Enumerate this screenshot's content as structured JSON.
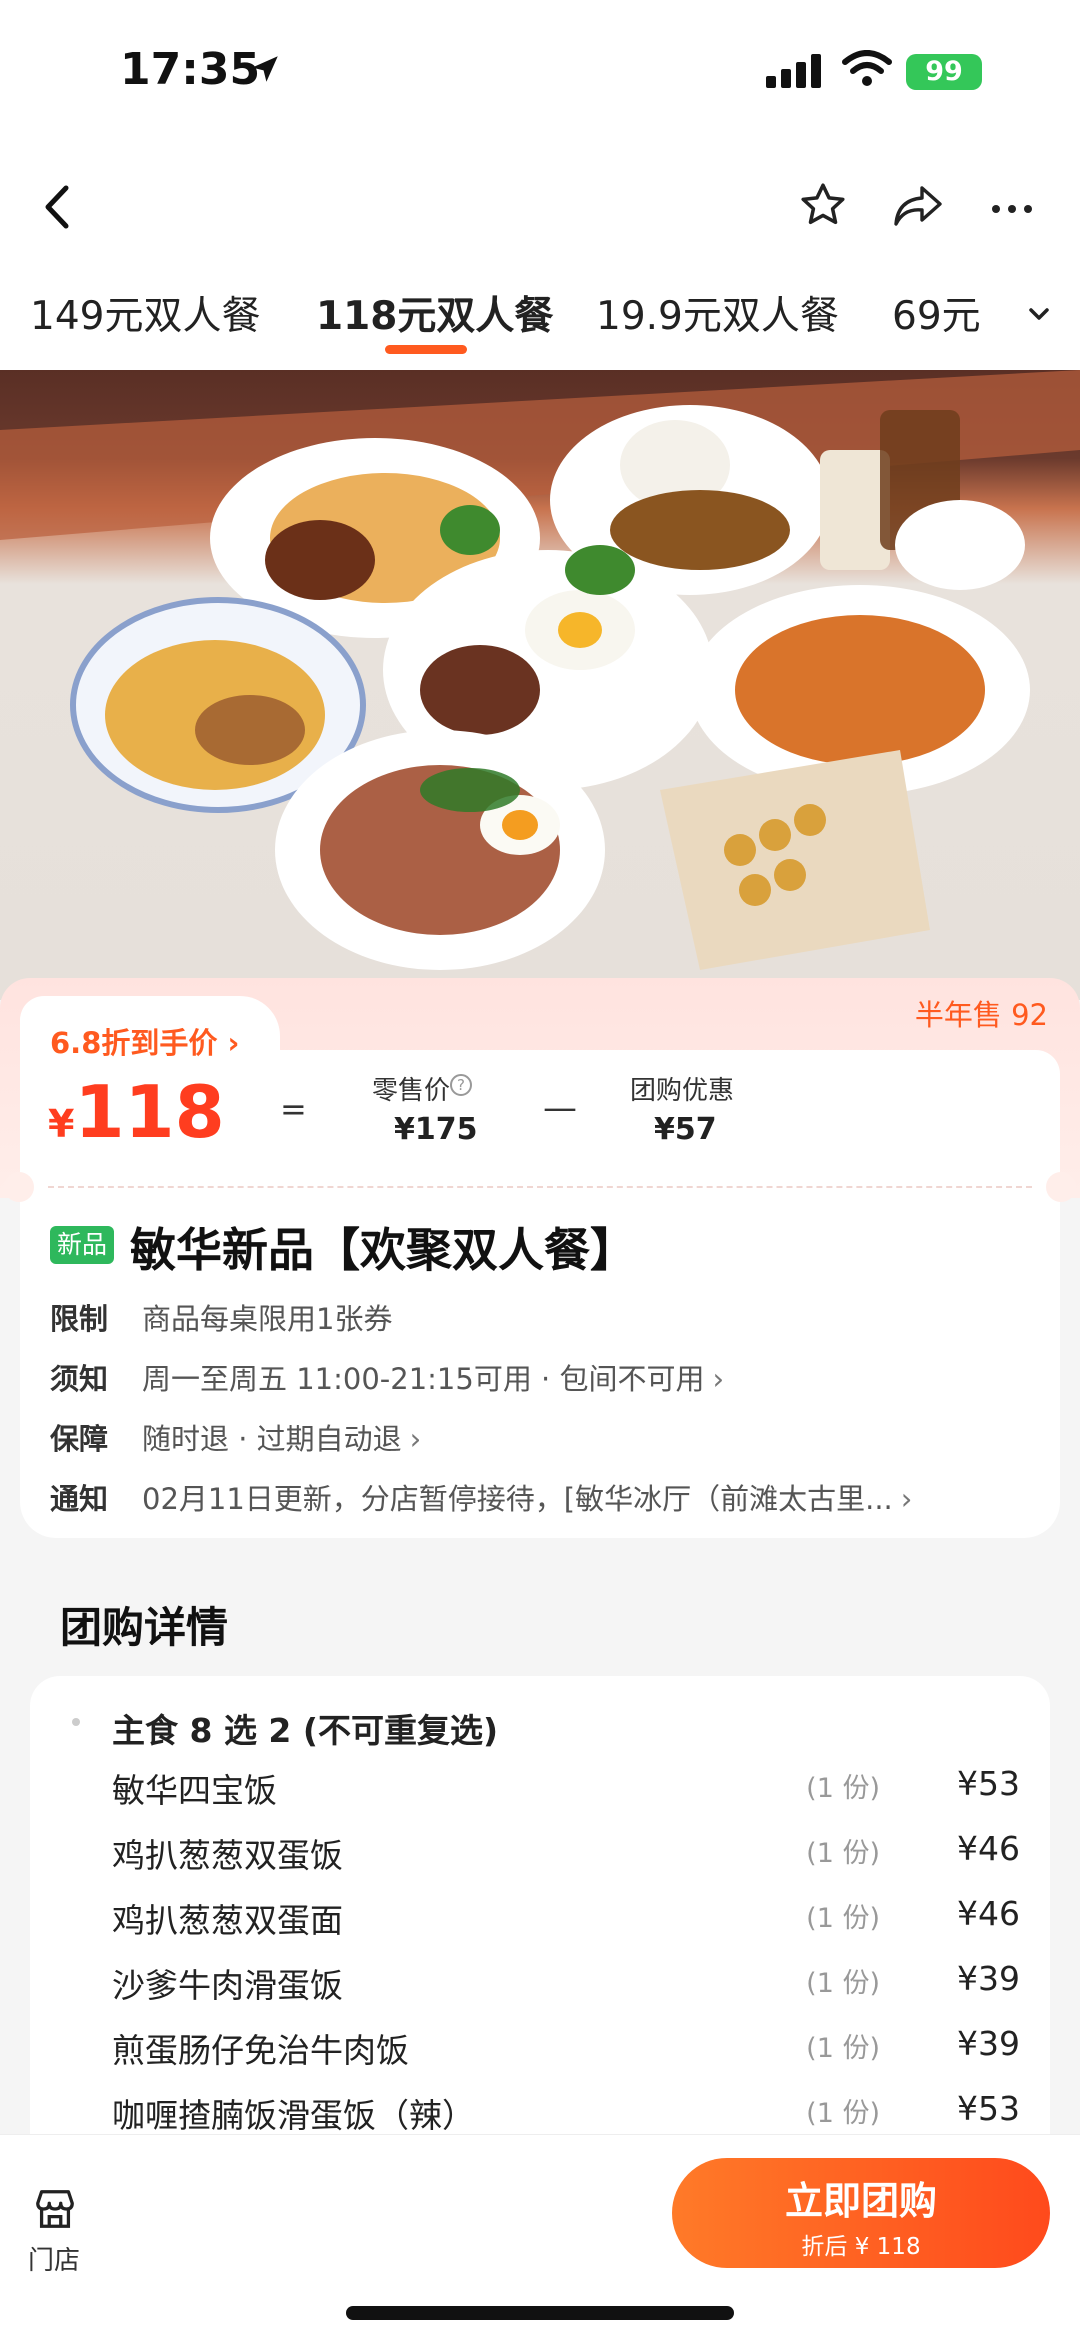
{
  "status_bar": {
    "time": "17:35",
    "battery": "99"
  },
  "tabs": [
    {
      "label": "149元双人餐"
    },
    {
      "label": "118元双人餐"
    },
    {
      "label": "19.9元双人餐"
    },
    {
      "label": "69元"
    }
  ],
  "price": {
    "discount_label": "6.8折到手价",
    "half_year_sales": "半年售 92",
    "currency": "¥",
    "amount": "118",
    "equals": "=",
    "retail_label": "零售价",
    "retail_value": "¥175",
    "minus": "—",
    "group_label": "团购优惠",
    "group_value": "¥57"
  },
  "product": {
    "badge": "新品",
    "title": "敏华新品【欢聚双人餐】",
    "rows": [
      {
        "key": "限制",
        "value": "商品每桌限用1张券"
      },
      {
        "key": "须知",
        "value": "周一至周五 11:00-21:15可用 · 包间不可用"
      },
      {
        "key": "保障",
        "value": "随时退 · 过期自动退"
      },
      {
        "key": "通知",
        "value": "02月11日更新，分店暂停接待，[敏华冰厅（前滩太古里..."
      }
    ]
  },
  "details": {
    "section_title": "团购详情",
    "group_head": "主食 8 选 2 (不可重复选)",
    "items": [
      {
        "name": "敏华四宝饭",
        "qty": "(1 份)",
        "price": "¥53"
      },
      {
        "name": "鸡扒葱葱双蛋饭",
        "qty": "(1 份)",
        "price": "¥46"
      },
      {
        "name": "鸡扒葱葱双蛋面",
        "qty": "(1 份)",
        "price": "¥46"
      },
      {
        "name": "沙爹牛肉滑蛋饭",
        "qty": "(1 份)",
        "price": "¥39"
      },
      {
        "name": "煎蛋肠仔免治牛肉饭",
        "qty": "(1 份)",
        "price": "¥39"
      },
      {
        "name": "咖喱揸腩饭滑蛋饭（辣）",
        "qty": "(1 份)",
        "price": "¥53"
      }
    ]
  },
  "bottom_bar": {
    "store_label": "门店",
    "buy_label": "立即团购",
    "buy_sub": "折后 ¥ 118"
  },
  "colors": {
    "accent": "#ff5a1f",
    "price_red": "#ff3d1f",
    "badge_green": "#2eb85c"
  }
}
